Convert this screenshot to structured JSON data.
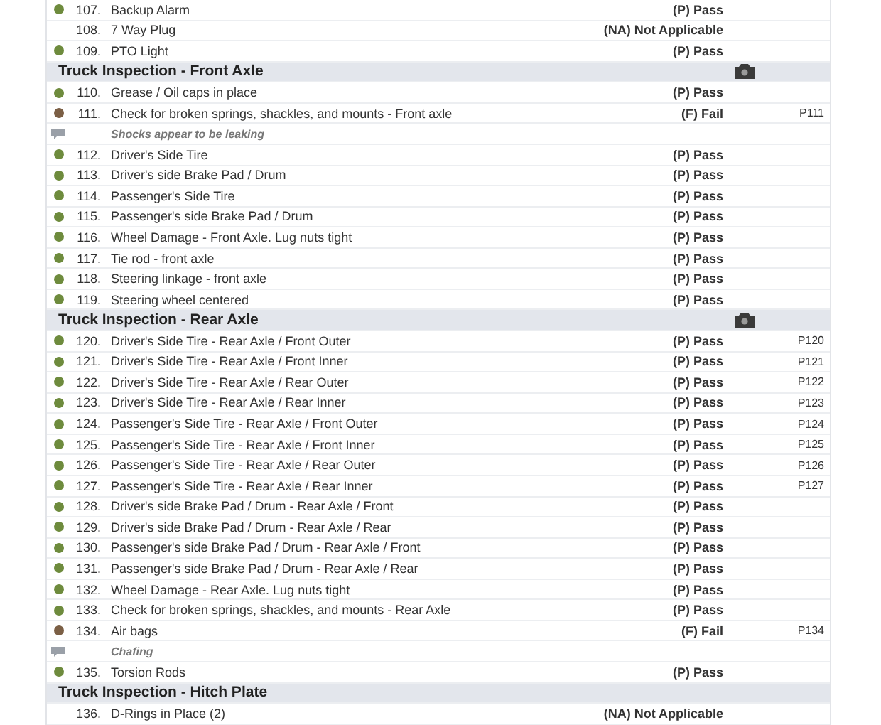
{
  "rows": [
    {
      "kind": "item",
      "number": "107.",
      "label": "Backup Alarm",
      "result": "(P) Pass",
      "color": "#6e8b3d"
    },
    {
      "kind": "item",
      "number": "108.",
      "label": "7 Way Plug",
      "result": "(NA) Not Applicable"
    },
    {
      "kind": "item",
      "number": "109.",
      "label": "PTO Light",
      "result": "(P) Pass",
      "color": "#6e8b3d"
    },
    {
      "kind": "section",
      "title": "Truck Inspection - Front Axle",
      "has_photo": true
    },
    {
      "kind": "item",
      "number": "110.",
      "label": "Grease / Oil caps in place",
      "result": "(P) Pass",
      "color": "#6e8b3d"
    },
    {
      "kind": "item",
      "number": "111.",
      "label": "Check for broken springs, shackles, and mounts - Front axle",
      "result": "(F) Fail",
      "color": "#7b5f45",
      "photo": "P111"
    },
    {
      "kind": "note",
      "text": "Shocks appear to be leaking"
    },
    {
      "kind": "item",
      "number": "112.",
      "label": "Driver's Side Tire",
      "result": "(P) Pass",
      "color": "#6e8b3d"
    },
    {
      "kind": "item",
      "number": "113.",
      "label": "Driver's side Brake Pad / Drum",
      "result": "(P) Pass",
      "color": "#6e8b3d"
    },
    {
      "kind": "item",
      "number": "114.",
      "label": "Passenger's Side Tire",
      "result": "(P) Pass",
      "color": "#6e8b3d"
    },
    {
      "kind": "item",
      "number": "115.",
      "label": "Passenger's side Brake Pad / Drum",
      "result": "(P) Pass",
      "color": "#6e8b3d"
    },
    {
      "kind": "item",
      "number": "116.",
      "label": "Wheel Damage - Front Axle. Lug nuts tight",
      "result": "(P) Pass",
      "color": "#6e8b3d"
    },
    {
      "kind": "item",
      "number": "117.",
      "label": "Tie rod - front axle",
      "result": "(P) Pass",
      "color": "#6e8b3d"
    },
    {
      "kind": "item",
      "number": "118.",
      "label": "Steering linkage - front axle",
      "result": "(P) Pass",
      "color": "#6e8b3d"
    },
    {
      "kind": "item",
      "number": "119.",
      "label": "Steering wheel centered",
      "result": "(P) Pass",
      "color": "#6e8b3d"
    },
    {
      "kind": "section",
      "title": "Truck Inspection - Rear Axle",
      "has_photo": true
    },
    {
      "kind": "item",
      "number": "120.",
      "label": "Driver's Side Tire - Rear Axle / Front Outer",
      "result": "(P) Pass",
      "color": "#6e8b3d",
      "photo": "P120"
    },
    {
      "kind": "item",
      "number": "121.",
      "label": "Driver's Side Tire - Rear Axle / Front Inner",
      "result": "(P) Pass",
      "color": "#6e8b3d",
      "photo": "P121"
    },
    {
      "kind": "item",
      "number": "122.",
      "label": "Driver's Side Tire - Rear Axle / Rear Outer",
      "result": "(P) Pass",
      "color": "#6e8b3d",
      "photo": "P122"
    },
    {
      "kind": "item",
      "number": "123.",
      "label": "Driver's Side Tire - Rear Axle / Rear Inner",
      "result": "(P) Pass",
      "color": "#6e8b3d",
      "photo": "P123"
    },
    {
      "kind": "item",
      "number": "124.",
      "label": "Passenger's Side Tire - Rear Axle / Front Outer",
      "result": "(P) Pass",
      "color": "#6e8b3d",
      "photo": "P124"
    },
    {
      "kind": "item",
      "number": "125.",
      "label": "Passenger's Side Tire - Rear Axle / Front Inner",
      "result": "(P) Pass",
      "color": "#6e8b3d",
      "photo": "P125"
    },
    {
      "kind": "item",
      "number": "126.",
      "label": "Passenger's Side Tire - Rear Axle / Rear Outer",
      "result": "(P) Pass",
      "color": "#6e8b3d",
      "photo": "P126"
    },
    {
      "kind": "item",
      "number": "127.",
      "label": "Passenger's Side Tire - Rear Axle / Rear Inner",
      "result": "(P) Pass",
      "color": "#6e8b3d",
      "photo": "P127"
    },
    {
      "kind": "item",
      "number": "128.",
      "label": "Driver's side Brake Pad / Drum - Rear Axle / Front",
      "result": "(P) Pass",
      "color": "#6e8b3d"
    },
    {
      "kind": "item",
      "number": "129.",
      "label": "Driver's side Brake Pad / Drum - Rear Axle / Rear",
      "result": "(P) Pass",
      "color": "#6e8b3d"
    },
    {
      "kind": "item",
      "number": "130.",
      "label": "Passenger's side Brake Pad / Drum - Rear Axle / Front",
      "result": "(P) Pass",
      "color": "#6e8b3d"
    },
    {
      "kind": "item",
      "number": "131.",
      "label": "Passenger's side Brake Pad / Drum - Rear Axle / Rear",
      "result": "(P) Pass",
      "color": "#6e8b3d"
    },
    {
      "kind": "item",
      "number": "132.",
      "label": "Wheel Damage - Rear Axle. Lug nuts tight",
      "result": "(P) Pass",
      "color": "#6e8b3d"
    },
    {
      "kind": "item",
      "number": "133.",
      "label": "Check for broken springs, shackles, and mounts - Rear Axle",
      "result": "(P) Pass",
      "color": "#6e8b3d"
    },
    {
      "kind": "item",
      "number": "134.",
      "label": "Air bags",
      "result": "(F) Fail",
      "color": "#7b5f45",
      "photo": "P134"
    },
    {
      "kind": "note",
      "text": "Chafing"
    },
    {
      "kind": "item",
      "number": "135.",
      "label": "Torsion Rods",
      "result": "(P) Pass",
      "color": "#6e8b3d"
    },
    {
      "kind": "section",
      "title": "Truck Inspection - Hitch Plate",
      "has_photo": false
    },
    {
      "kind": "item",
      "number": "136.",
      "label": "D-Rings in Place (2)",
      "result": "(NA) Not Applicable"
    }
  ]
}
